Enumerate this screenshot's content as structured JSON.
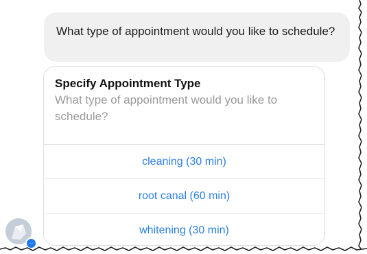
{
  "message": {
    "text": "What type of appointment would you like to schedule?"
  },
  "card": {
    "title": "Specify Appointment Type",
    "subtitle": "What type of appointment would you like to schedule?",
    "options": [
      {
        "label": "cleaning (30 min)"
      },
      {
        "label": "root canal (60 min)"
      },
      {
        "label": "whitening (30 min)"
      }
    ]
  },
  "avatar": {
    "icon": "bot-avatar-icon",
    "badge_icon": "messenger-badge-icon",
    "badge_color": "#1a78f2"
  },
  "colors": {
    "bubble_bg": "#f0f0f0",
    "option_text": "#2a7fe0",
    "subtitle_text": "#9a9a9a"
  }
}
